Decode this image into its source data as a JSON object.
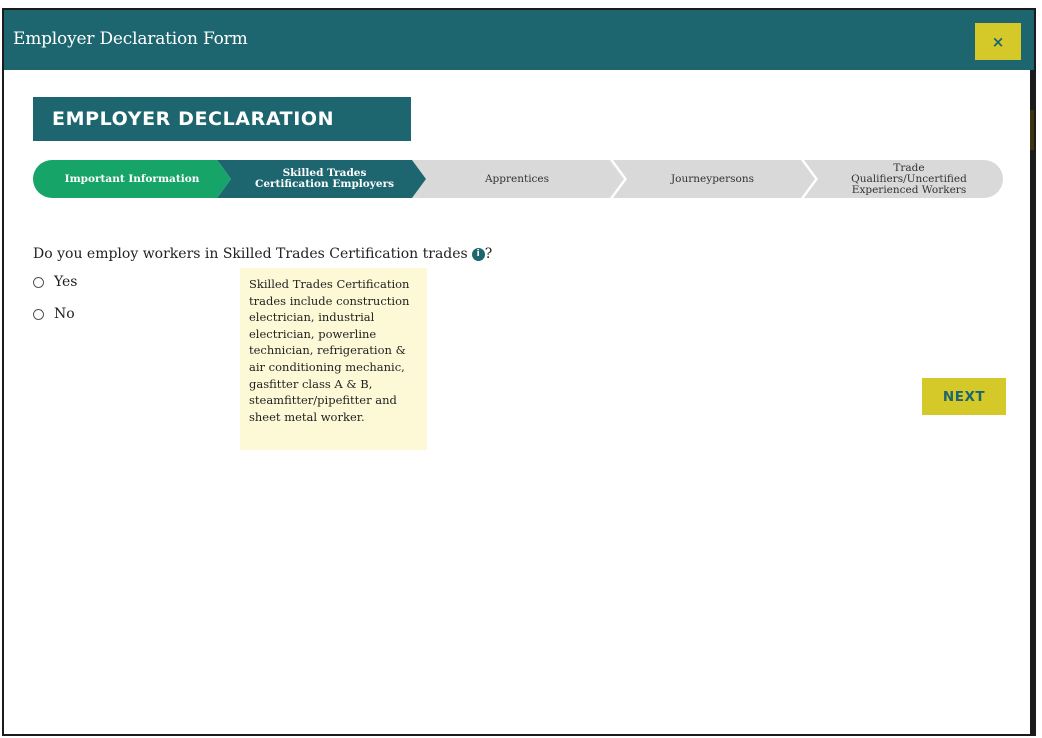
{
  "window": {
    "title": "Employer Declaration Form",
    "close_label": "×"
  },
  "form": {
    "heading": "EMPLOYER DECLARATION"
  },
  "stepper": {
    "steps": [
      {
        "label": "Important Information",
        "state": "completed"
      },
      {
        "label": "Skilled Trades Certification Employers",
        "state": "current"
      },
      {
        "label": "Apprentices",
        "state": "upcoming"
      },
      {
        "label": "Journeypersons",
        "state": "upcoming"
      },
      {
        "label": "Trade Qualifiers/Uncertified Experienced Workers",
        "state": "upcoming"
      }
    ]
  },
  "question": {
    "text": "Do you employ workers in Skilled Trades Certification trades",
    "suffix": "?",
    "info_icon": "i",
    "options": [
      {
        "label": "Yes",
        "checked": false
      },
      {
        "label": "No",
        "checked": false
      }
    ]
  },
  "tooltip": {
    "text": "Skilled Trades Certification trades include construction electrician, industrial electrician, powerline technician, refrigeration & air conditioning mechanic, gasfitter class A & B, steamfitter/pipefitter and sheet metal worker."
  },
  "actions": {
    "next_label": "NEXT"
  },
  "colors": {
    "primary": "#1d6670",
    "success": "#17a468",
    "accent": "#d4c928",
    "inactive": "#d9d9d9",
    "tooltip_bg": "#fdf9d6"
  }
}
